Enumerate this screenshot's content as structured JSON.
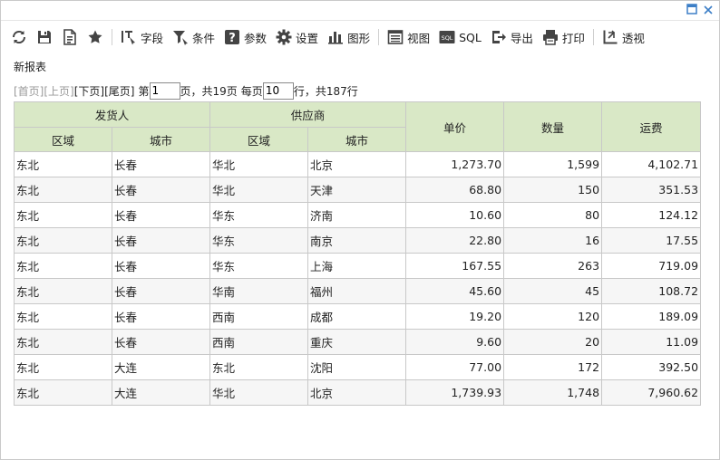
{
  "window": {
    "maximize_icon": "maximize-icon",
    "close_icon": "close-icon"
  },
  "toolbar": {
    "items": [
      {
        "icon": "refresh-icon",
        "label": ""
      },
      {
        "icon": "save-icon",
        "label": ""
      },
      {
        "icon": "save-as-icon",
        "label": ""
      },
      {
        "icon": "star-icon",
        "label": ""
      },
      {
        "icon": "field-icon",
        "label": "字段"
      },
      {
        "icon": "filter-icon",
        "label": "条件"
      },
      {
        "icon": "param-icon",
        "label": "参数"
      },
      {
        "icon": "gear-icon",
        "label": "设置"
      },
      {
        "icon": "chart-icon",
        "label": "图形"
      },
      {
        "icon": "view-icon",
        "label": "视图"
      },
      {
        "icon": "sql-icon",
        "label": "SQL"
      },
      {
        "icon": "export-icon",
        "label": "导出"
      },
      {
        "icon": "print-icon",
        "label": "打印"
      },
      {
        "icon": "pivot-icon",
        "label": "透视"
      }
    ]
  },
  "report": {
    "title": "新报表"
  },
  "pager": {
    "first": "[首页]",
    "prev": "[上页]",
    "next": "[下页]",
    "last": "[尾页]",
    "page_prefix": "第",
    "page_value": "1",
    "total_pages_text": "页，共19页",
    "per_page_prefix": "每页",
    "per_page_value": "10",
    "total_rows_text": "行，共187行"
  },
  "table": {
    "group_headers": {
      "shipper": "发货人",
      "supplier": "供应商",
      "price": "单价",
      "qty": "数量",
      "freight": "运费"
    },
    "sub_headers": {
      "shipper_region": "区域",
      "shipper_city": "城市",
      "supplier_region": "区域",
      "supplier_city": "城市"
    },
    "rows": [
      [
        "东北",
        "长春",
        "华北",
        "北京",
        "1,273.70",
        "1,599",
        "4,102.71"
      ],
      [
        "东北",
        "长春",
        "华北",
        "天津",
        "68.80",
        "150",
        "351.53"
      ],
      [
        "东北",
        "长春",
        "华东",
        "济南",
        "10.60",
        "80",
        "124.12"
      ],
      [
        "东北",
        "长春",
        "华东",
        "南京",
        "22.80",
        "16",
        "17.55"
      ],
      [
        "东北",
        "长春",
        "华东",
        "上海",
        "167.55",
        "263",
        "719.09"
      ],
      [
        "东北",
        "长春",
        "华南",
        "福州",
        "45.60",
        "45",
        "108.72"
      ],
      [
        "东北",
        "长春",
        "西南",
        "成都",
        "19.20",
        "120",
        "189.09"
      ],
      [
        "东北",
        "长春",
        "西南",
        "重庆",
        "9.60",
        "20",
        "11.09"
      ],
      [
        "东北",
        "大连",
        "东北",
        "沈阳",
        "77.00",
        "172",
        "392.50"
      ],
      [
        "东北",
        "大连",
        "华北",
        "北京",
        "1,739.93",
        "1,748",
        "7,960.62"
      ]
    ]
  }
}
